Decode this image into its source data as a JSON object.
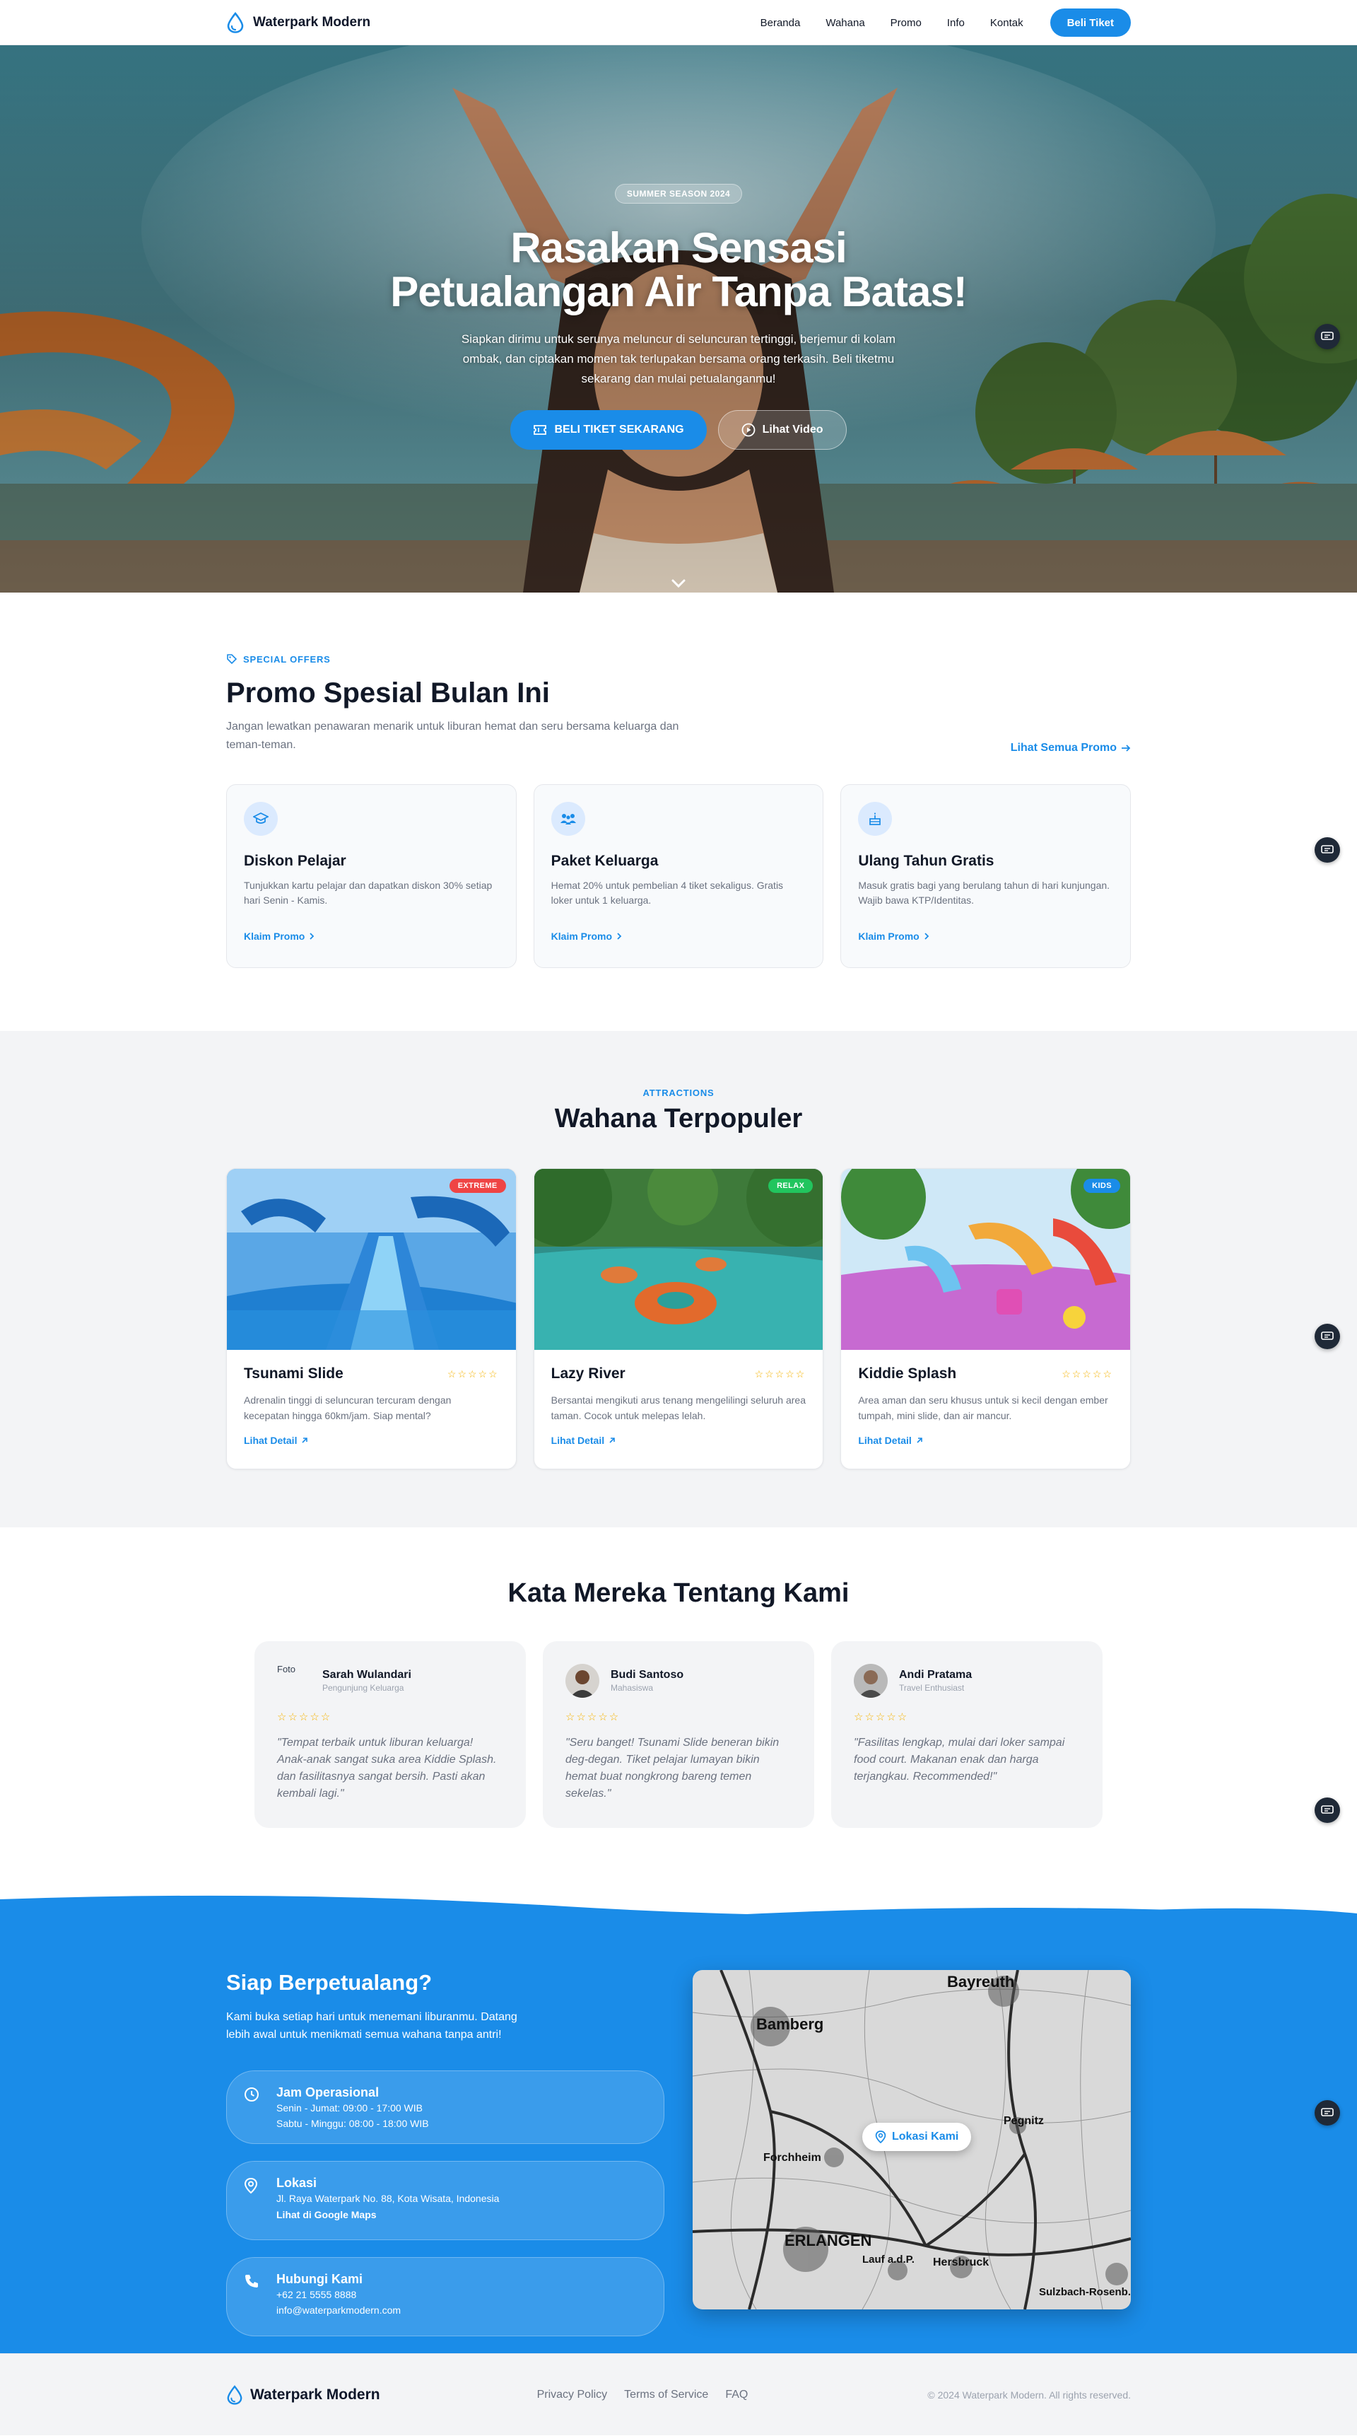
{
  "colors": {
    "primary": "#1a8ce8",
    "dark": "#111827",
    "muted": "#6b7280",
    "star": "#f5b301"
  },
  "nav": {
    "brand": "Waterpark Modern",
    "links": [
      "Beranda",
      "Wahana",
      "Promo",
      "Info",
      "Kontak"
    ],
    "cta": "Beli Tiket",
    "logo_icon": "water-drop-icon"
  },
  "hero": {
    "badge": "SUMMER SEASON 2024",
    "title_line1": "Rasakan Sensasi",
    "title_line2": "Petualangan Air Tanpa Batas!",
    "subtitle": "Siapkan dirimu untuk serunya meluncur di seluncuran tertinggi, berjemur di kolam ombak, dan ciptakan momen tak terlupakan bersama orang terkasih. Beli tiketmu sekarang dan mulai petualanganmu!",
    "primary_button": "BELI TIKET SEKARANG",
    "secondary_button": "Lihat Video"
  },
  "promo": {
    "eyebrow": "SPECIAL OFFERS",
    "title": "Promo Spesial Bulan Ini",
    "description": "Jangan lewatkan penawaran menarik untuk liburan hemat dan seru bersama keluarga dan teman-teman.",
    "see_all": "Lihat Semua Promo",
    "cards": [
      {
        "icon": "graduation-cap-icon",
        "title": "Diskon Pelajar",
        "text": "Tunjukkan kartu pelajar dan dapatkan diskon 30% setiap hari Senin - Kamis.",
        "link": "Klaim Promo"
      },
      {
        "icon": "family-icon",
        "title": "Paket Keluarga",
        "text": "Hemat 20% untuk pembelian 4 tiket sekaligus. Gratis loker untuk 1 keluarga.",
        "link": "Klaim Promo"
      },
      {
        "icon": "birthday-cake-icon",
        "title": "Ulang Tahun Gratis",
        "text": "Masuk gratis bagi yang berulang tahun di hari kunjungan. Wajib bawa KTP/Identitas.",
        "link": "Klaim Promo"
      }
    ]
  },
  "wahana": {
    "eyebrow": "ATTRACTIONS",
    "title": "Wahana Terpopuler",
    "cards": [
      {
        "tag": "EXTREME",
        "tag_color": "#ef4444",
        "title": "Tsunami Slide",
        "stars": "☆☆☆☆☆",
        "text": "Adrenalin tinggi di seluncuran tercuram dengan kecepatan hingga 60km/jam. Siap mental?",
        "link": "Lihat Detail"
      },
      {
        "tag": "RELAX",
        "tag_color": "#22c55e",
        "title": "Lazy River",
        "stars": "☆☆☆☆☆",
        "text": "Bersantai mengikuti arus tenang mengelilingi seluruh area taman. Cocok untuk melepas lelah.",
        "link": "Lihat Detail"
      },
      {
        "tag": "KIDS",
        "tag_color": "#1a8ce8",
        "title": "Kiddie Splash",
        "stars": "☆☆☆☆☆",
        "text": "Area aman dan seru khusus untuk si kecil dengan ember tumpah, mini slide, dan air mancur.",
        "link": "Lihat Detail"
      }
    ]
  },
  "testimonials": {
    "title": "Kata Mereka Tentang Kami",
    "items": [
      {
        "avatar_alt": "Foto",
        "name": "Sarah Wulandari",
        "role": "Pengunjung Keluarga",
        "stars": "☆☆☆☆☆",
        "quote": "\"Tempat terbaik untuk liburan keluarga! Anak-anak sangat suka area Kiddie Splash. dan fasilitasnya sangat bersih. Pasti akan kembali lagi.\""
      },
      {
        "avatar_alt": "",
        "name": "Budi Santoso",
        "role": "Mahasiswa",
        "stars": "☆☆☆☆☆",
        "quote": "\"Seru banget! Tsunami Slide beneran bikin deg-degan. Tiket pelajar lumayan bikin hemat buat nongkrong bareng temen sekelas.\""
      },
      {
        "avatar_alt": "",
        "name": "Andi Pratama",
        "role": "Travel Enthusiast",
        "stars": "☆☆☆☆☆",
        "quote": "\"Fasilitas lengkap, mulai dari loker sampai food court. Makanan enak dan harga terjangkau. Recommended!\""
      }
    ]
  },
  "cta": {
    "title": "Siap Berpetualang?",
    "lead": "Kami buka setiap hari untuk menemani liburanmu. Datang lebih awal untuk menikmati semua wahana tanpa antri!",
    "hours": {
      "title": "Jam Operasional",
      "line1": "Senin - Jumat: 09:00 - 17:00 WIB",
      "line2": "Sabtu - Minggu: 08:00 - 18:00 WIB"
    },
    "location": {
      "title": "Lokasi",
      "line1": "Jl. Raya Waterpark No. 88, Kota Wisata, Indonesia",
      "link": "Lihat di Google Maps"
    },
    "contact": {
      "title": "Hubungi Kami",
      "phone": "+62 21 5555 8888",
      "email": "info@waterparkmodern.com"
    },
    "map_label": "Lokasi Kami",
    "map_places": [
      "Bamberg",
      "Bayreuth",
      "Forchheim",
      "ERLANGEN",
      "Pegnitz",
      "Lauf a.d.P.",
      "Hersbruck",
      "Sulzbach-Rosenb."
    ]
  },
  "footer": {
    "brand": "Waterpark Modern",
    "links": [
      "Privacy Policy",
      "Terms of Service",
      "FAQ"
    ],
    "copyright": "© 2024 Waterpark Modern. All rights reserved."
  }
}
